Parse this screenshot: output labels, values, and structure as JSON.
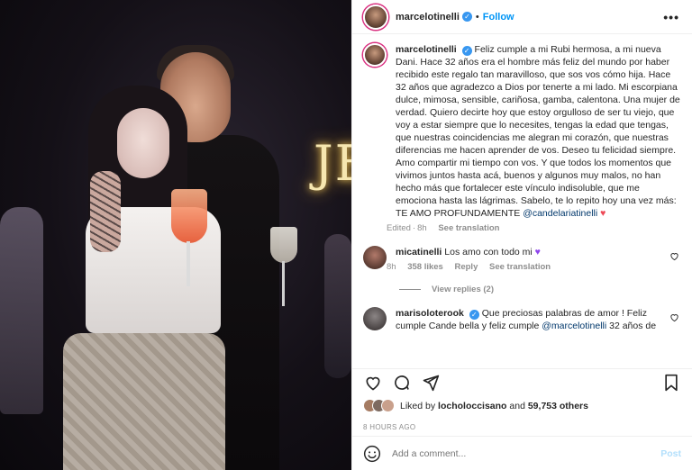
{
  "header": {
    "username": "marcelotinelli",
    "verified_mark": "✓",
    "separator": "•",
    "follow_label": "Follow",
    "more_label": "•••"
  },
  "caption": {
    "username": "marcelotinelli",
    "text_1": "Feliz cumple a mi Rubi hermosa, a mi nueva Dani. Hace 32 años era el hombre más feliz del mundo por haber recibido este regalo tan maravilloso, que sos vos cómo hija. Hace 32 años que agradezco a Dios por tenerte a mi lado. Mi escorpiana dulce, mimosa, sensible, cariñosa, gamba, calentona. Una mujer de verdad. Quiero decirte hoy que estoy orgulloso de ser tu viejo, que voy a estar siempre que lo necesites, tengas la edad que tengas, que nuestras coincidencias me alegran mi corazón, que nuestras diferencias me hacen aprender de vos. Deseo tu felicidad siempre. Amo compartir mi tiempo con vos. Y que todos los momentos que vivimos juntos hasta acá, buenos y algunos muy malos, no han hecho más que fortalecer este vínculo indisoluble, que me emociona hasta las lágrimas. Sabelo, te lo repito hoy una vez más: TE AMO PROFUNDAMENTE",
    "mention": "@candelariatinelli",
    "heart": "♥",
    "edited": "Edited",
    "time": "8h",
    "see_translation": "See translation"
  },
  "comments": [
    {
      "username": "micatinelli",
      "text": "Los amo con todo mi",
      "emoji": "♥",
      "time": "8h",
      "likes": "358 likes",
      "reply": "Reply",
      "see_translation": "See translation"
    },
    {
      "username": "marisoloterook",
      "text_1": "Que preciosas palabras de amor ! Feliz cumple Cande bella y feliz cumple",
      "mention": "@marcelotinelli",
      "text_2": "32 años de"
    }
  ],
  "view_replies": "View replies (2)",
  "likes": {
    "prefix": "Liked by",
    "user": "locholoccisano",
    "and": "and",
    "count": "59,753 others"
  },
  "timestamp": "8 HOURS AGO",
  "add_comment": {
    "placeholder": "Add a comment...",
    "post_label": "Post"
  },
  "photo": {
    "neon_text": "JE"
  }
}
